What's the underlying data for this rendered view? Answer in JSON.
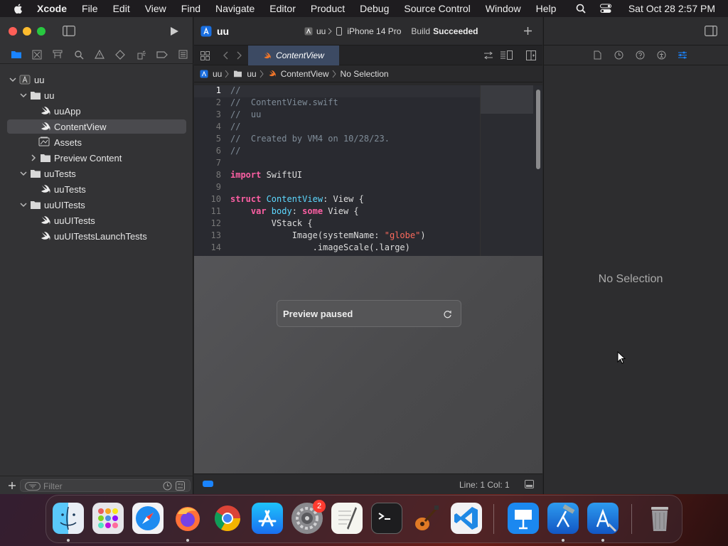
{
  "menubar": {
    "app_name": "Xcode",
    "items": [
      "File",
      "Edit",
      "View",
      "Find",
      "Navigate",
      "Editor",
      "Product",
      "Debug",
      "Source Control",
      "Window",
      "Help"
    ],
    "datetime": "Sat Oct 28  2:57 PM"
  },
  "toolbar": {
    "project_title": "uu",
    "scheme": "uu",
    "device": "iPhone 14 Pro",
    "build_status_prefix": "Build",
    "build_status": "Succeeded"
  },
  "navigator": {
    "items": [
      {
        "label": "uu"
      },
      {
        "label": "uu"
      },
      {
        "label": "uuApp"
      },
      {
        "label": "ContentView"
      },
      {
        "label": "Assets"
      },
      {
        "label": "Preview Content"
      },
      {
        "label": "uuTests"
      },
      {
        "label": "uuTests"
      },
      {
        "label": "uuUITests"
      },
      {
        "label": "uuUITests"
      },
      {
        "label": "uuUITestsLaunchTests"
      }
    ],
    "filter_placeholder": "Filter"
  },
  "editor": {
    "tab_label": "ContentView",
    "jumpbar": [
      "uu",
      "uu",
      "ContentView",
      "No Selection"
    ],
    "line_numbers": [
      "1",
      "2",
      "3",
      "4",
      "5",
      "6",
      "7",
      "8",
      "9",
      "10",
      "11",
      "12",
      "13",
      "14"
    ],
    "code": {
      "l1": "//",
      "l2": "//  ContentView.swift",
      "l3": "//  uu",
      "l4": "//",
      "l5": "//  Created by VM4 on 10/28/23.",
      "l6": "//",
      "l8_kw": "import",
      "l8_rest": " SwiftUI",
      "l10_kw": "struct",
      "l10_ty": " ContentView",
      "l10_rest": ": View {",
      "l11_kw1": "    var",
      "l11_ty": " body",
      "l11_mid": ":",
      "l11_kw2": " some",
      "l11_rest": " View {",
      "l12": "        VStack {",
      "l13_pre": "            Image(systemName: ",
      "l13_str": "\"globe\"",
      "l13_post": ")",
      "l14": "                .imageScale(.large)"
    },
    "preview_status": "Preview paused",
    "cursor_position": "Line: 1  Col: 1"
  },
  "inspector": {
    "empty_text": "No Selection"
  },
  "dock": {
    "settings_badge": "2"
  },
  "colors": {
    "accent": "#1a84ff",
    "keyword": "#fc5fa3",
    "type": "#5dd8ff",
    "string": "#fc6a5d",
    "comment": "#7f8c98"
  }
}
